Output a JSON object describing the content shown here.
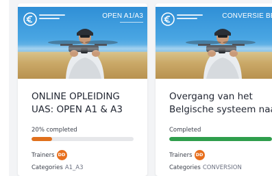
{
  "courses": [
    {
      "thumb_tag": "OPEN A1/A3",
      "title_line1": "ONLINE OPLEIDING",
      "title_line2": "UAS: OPEN A1 & A3",
      "progress_text": "20% completed",
      "progress_value": 0.2,
      "progress_color": "#e0701c",
      "trainers_label": "Trainers",
      "trainer_initials": "DD",
      "avatar_color": "#e86f1d",
      "categories_label": "Categories",
      "categories_value": "A1_A3"
    },
    {
      "thumb_tag": "CONVERSIE BEL-",
      "title_line1": "Overgang van het",
      "title_line2": "Belgische systeem naar",
      "progress_text": "Completed",
      "progress_value": 1.0,
      "progress_color": "#2f9e4c",
      "trainers_label": "Trainers",
      "trainer_initials": "DD",
      "avatar_color": "#e86f1d",
      "categories_label": "Categories",
      "categories_value": "CONVERSION"
    }
  ],
  "icons": {
    "brand_logo": "euro-sign-logo-icon"
  }
}
